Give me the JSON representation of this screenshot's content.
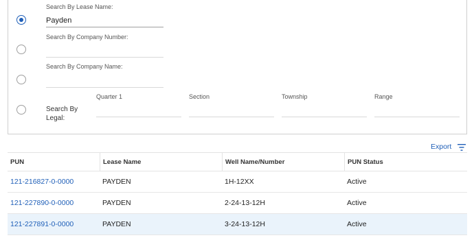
{
  "search": {
    "lease_name": {
      "label": "Search By Lease Name:",
      "value": "Payden"
    },
    "company_number": {
      "label": "Search By Company Number:",
      "value": ""
    },
    "company_name": {
      "label": "Search By Company Name:",
      "value": ""
    },
    "legal": {
      "label_line1": "Search By",
      "label_line2": "Legal:",
      "fields": [
        "Quarter 1",
        "Section",
        "Township",
        "Range"
      ]
    }
  },
  "toolbar": {
    "export_label": "Export",
    "filter_icon": "filter-icon"
  },
  "table": {
    "columns": [
      "PUN",
      "Lease Name",
      "Well Name/Number",
      "PUN Status"
    ],
    "rows": [
      {
        "pun": "121-216827-0-0000",
        "lease": "PAYDEN",
        "well": "1H-12XX",
        "status": "Active"
      },
      {
        "pun": "121-227890-0-0000",
        "lease": "PAYDEN",
        "well": "2-24-13-12H",
        "status": "Active"
      },
      {
        "pun": "121-227891-0-0000",
        "lease": "PAYDEN",
        "well": "3-24-13-12H",
        "status": "Active"
      }
    ]
  },
  "colors": {
    "accent": "#1f5fb8",
    "row_highlight": "#eaf3fb"
  }
}
